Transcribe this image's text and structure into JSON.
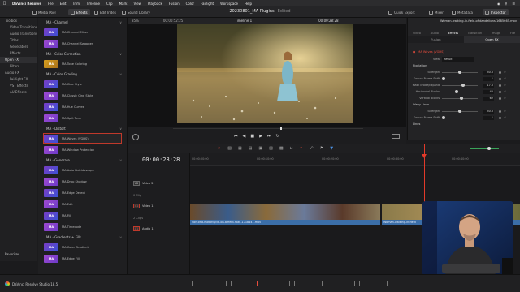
{
  "menubar": {
    "app": "DaVinci Resolve",
    "items": [
      "File",
      "Edit",
      "Trim",
      "Timeline",
      "Clip",
      "Mark",
      "View",
      "Playback",
      "Fusion",
      "Color",
      "Fairlight",
      "Workspace",
      "Help"
    ]
  },
  "toolbar": {
    "media_pool": "Media Pool",
    "effects": "Effects",
    "edit_index": "Edit Index",
    "sound_library": "Sound Library",
    "project_title": "20230801_MA Plugins",
    "edited": "Edited",
    "quick_export": "Quick Export",
    "mixer": "Mixer",
    "metadata": "Metadata",
    "inspector": "Inspector"
  },
  "bins": [
    {
      "label": "Toolbox",
      "sub": false
    },
    {
      "label": "Video Transitions",
      "sub": true
    },
    {
      "label": "Audio Transitions",
      "sub": true
    },
    {
      "label": "Titles",
      "sub": true
    },
    {
      "label": "Generators",
      "sub": true
    },
    {
      "label": "Effects",
      "sub": true
    },
    {
      "label": "Open FX",
      "sub": false,
      "selected": true
    },
    {
      "label": "Filters",
      "sub": true
    },
    {
      "label": "Audio FX",
      "sub": false
    },
    {
      "label": "Fairlight FX",
      "sub": true
    },
    {
      "label": "VST Effects",
      "sub": true
    },
    {
      "label": "AU Effects",
      "sub": true
    }
  ],
  "favorites_label": "Favorites",
  "effects_groups": [
    {
      "title": "MA - Channel",
      "items": [
        {
          "thumb": "MA",
          "label": "MA Channel Mixer"
        },
        {
          "thumb": "MA",
          "label": "MA Channel Swapper"
        }
      ]
    },
    {
      "title": "MA - Color Correction",
      "items": [
        {
          "thumb": "MA",
          "label": "MA Tone Coloring",
          "yellow": true
        }
      ]
    },
    {
      "title": "MA - Color Grading",
      "items": [
        {
          "thumb": "MA",
          "label": "MA Cine Style"
        },
        {
          "thumb": "MA",
          "label": "MA Classic Cine Style"
        },
        {
          "thumb": "MA",
          "label": "MA Hue Curves"
        },
        {
          "thumb": "MA",
          "label": "MA Split Tone"
        }
      ]
    },
    {
      "title": "MA - Distort",
      "items": [
        {
          "thumb": "MA",
          "label": "MA Waves (VGHS)",
          "highlight": true
        },
        {
          "thumb": "MA",
          "label": "MA Window Protection"
        }
      ]
    },
    {
      "title": "MA - Generate",
      "items": [
        {
          "thumb": "MA",
          "label": "MA Auto Kaleidoscope"
        },
        {
          "thumb": "MA",
          "label": "MA Drop Shadow"
        },
        {
          "thumb": "MA",
          "label": "MA Edge Detect"
        },
        {
          "thumb": "MA",
          "label": "MA Edit"
        },
        {
          "thumb": "MA",
          "label": "MA Fill"
        },
        {
          "thumb": "MA",
          "label": "MA Timecode"
        }
      ]
    },
    {
      "title": "MA - Gradients + Fills",
      "items": [
        {
          "thumb": "MA",
          "label": "MA Color Gradient"
        },
        {
          "thumb": "MA",
          "label": "MA Edge Fill"
        }
      ]
    }
  ],
  "viewer": {
    "zoom": "35%",
    "source_tc": "00:00:52:25",
    "timeline_name": "Timeline 1",
    "record_tc": "00:00:28:28"
  },
  "inspector": {
    "clip_name": "Woman-walking-in-field-of-dandelions-1685665.mov",
    "tabs": [
      "Video",
      "Audio",
      "Effects",
      "Transition",
      "Image",
      "File"
    ],
    "active_tab": "Effects",
    "subtabs": [
      "Fusion",
      "Open FX"
    ],
    "effect_name": "MA Waves (VGHS)",
    "view_label": "View",
    "view_value": "Result",
    "sections": [
      {
        "title": "Pixelation",
        "params": [
          {
            "label": "Strength",
            "value": "50.0",
            "fraction": 0.5
          },
          {
            "label": "Source Frame Shift",
            "value": "1",
            "fraction": 0.05
          },
          {
            "label": "Mask Erode/Expand",
            "value": "17.0",
            "fraction": 0.58
          },
          {
            "label": "Horizontal Blocks",
            "value": "45",
            "fraction": 0.4
          },
          {
            "label": "Vertical Blocks",
            "value": "62",
            "fraction": 0.55
          }
        ]
      },
      {
        "title": "Wavy Lines",
        "params": [
          {
            "label": "Strength",
            "value": "50.0",
            "fraction": 0.5
          },
          {
            "label": "Source Frame Shift",
            "value": "1",
            "fraction": 0.05
          }
        ]
      },
      {
        "title": "Lines",
        "params": []
      }
    ]
  },
  "timeline": {
    "timecode": "00:00:28:28",
    "ruler": [
      "00:00:00:00",
      "00:00:10:00",
      "00:00:20:00",
      "00:00:30:00",
      "00:00:40:00"
    ],
    "tracks": [
      {
        "tag": "V2",
        "name": "Video 2",
        "clips": "0 Clip"
      },
      {
        "tag": "V1",
        "name": "Video 1",
        "clips": "2 Clips"
      },
      {
        "tag": "A1",
        "name": "Audio 1",
        "clips": ""
      }
    ],
    "clip1": "Son-of-a-motorcycle-on-a-field-road-1718441.mov",
    "clip2": "Woman-walking-in-field"
  },
  "bottombar": {
    "brand": "DaVinci Resolve Studio 18.5"
  }
}
